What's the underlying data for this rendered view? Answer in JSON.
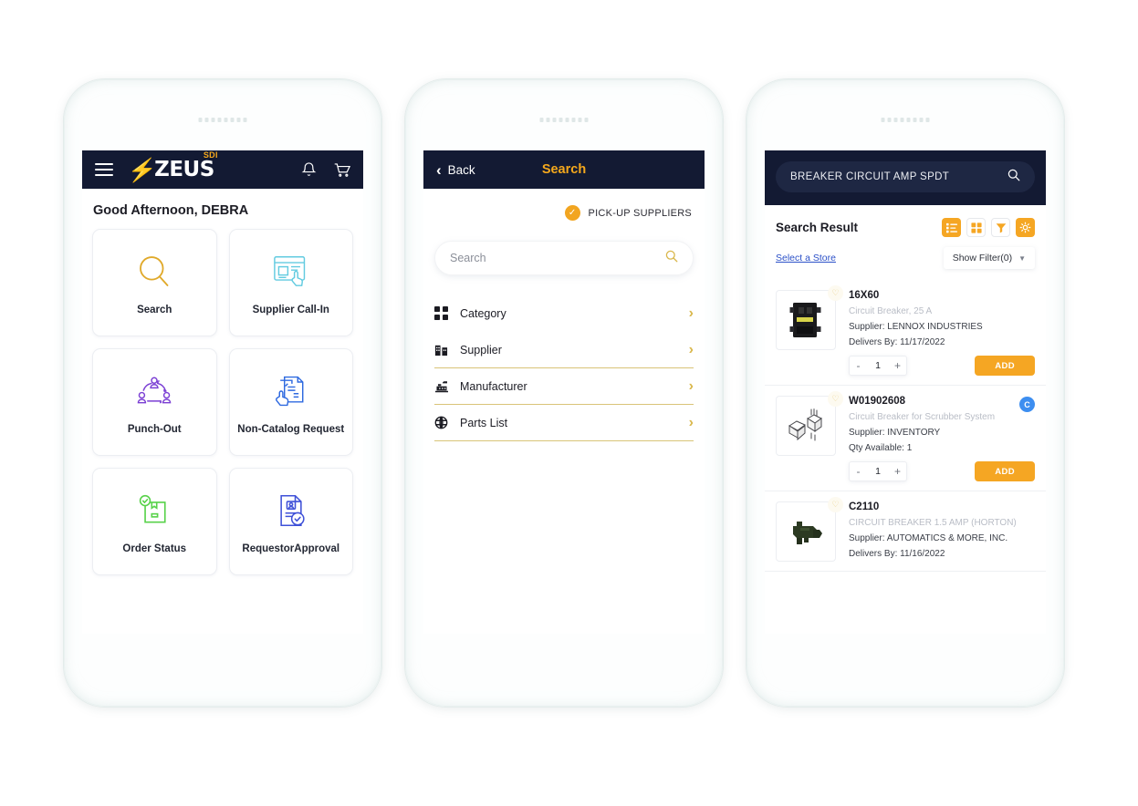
{
  "colors": {
    "nav_dark": "#131a33",
    "accent_orange": "#f5a623",
    "gold": "#d9b74b",
    "link_blue": "#2b50c8",
    "badge_blue": "#3d8ef0"
  },
  "phone_home": {
    "navbar": {
      "menu_icon": "hamburger-icon",
      "logo_bolt": "⚡",
      "logo_text": "ZEUS",
      "logo_super": "SDI",
      "bell_icon": "bell-icon",
      "cart_icon": "cart-icon"
    },
    "greeting": "Good Afternoon, DEBRA",
    "tiles": [
      {
        "label": "Search",
        "icon": "magnifier-icon",
        "color": "#e0a92a"
      },
      {
        "label": "Supplier Call-In",
        "icon": "window-click-icon",
        "color": "#62cbe0"
      },
      {
        "label": "Punch-Out",
        "icon": "network-users-icon",
        "color": "#7b3fd4"
      },
      {
        "label": "Non-Catalog\nRequest",
        "icon": "documents-hand-icon",
        "color": "#2f6ae0"
      },
      {
        "label": "Order Status",
        "icon": "box-check-icon",
        "color": "#58d24a"
      },
      {
        "label": "RequestorApproval",
        "icon": "document-person-check-icon",
        "color": "#3f51d8"
      }
    ]
  },
  "phone_search": {
    "navbar": {
      "back_label": "Back",
      "title": "Search",
      "back_icon": "chevron-left-icon"
    },
    "pickup": {
      "label": "PICK-UP SUPPLIERS",
      "checked": true,
      "icon": "check-circle-icon"
    },
    "search": {
      "value": "",
      "placeholder": "Search",
      "icon": "search-icon"
    },
    "menu_items": [
      {
        "label": "Category",
        "icon": "grid-squares-icon",
        "ruled": false
      },
      {
        "label": "Supplier",
        "icon": "building-icon",
        "ruled": true
      },
      {
        "label": "Manufacturer",
        "icon": "factory-icon",
        "ruled": true
      },
      {
        "label": "Parts List",
        "icon": "globe-grid-icon",
        "ruled": true
      }
    ],
    "chevron_icon": "chevron-right-icon"
  },
  "phone_results": {
    "search": {
      "value": "BREAKER CIRCUIT AMP SPDT",
      "placeholder": "Search",
      "icon": "search-icon"
    },
    "result_title": "Search Result",
    "toolbar": [
      {
        "name": "list-view-button",
        "icon": "list-view-icon",
        "style": "solid"
      },
      {
        "name": "grid-view-button",
        "icon": "grid-view-icon",
        "style": "ghost"
      },
      {
        "name": "filter-button",
        "icon": "funnel-icon",
        "style": "ghost"
      },
      {
        "name": "settings-button",
        "icon": "gear-icon",
        "style": "solid"
      }
    ],
    "store_link": "Select a Store",
    "show_filter": {
      "label": "Show Filter(0)",
      "caret": "▼"
    },
    "products": [
      {
        "code": "16X60",
        "description": "Circuit Breaker, 25 A",
        "supplier": "Supplier: LENNOX INDUSTRIES",
        "meta2": "Delivers By:  11/17/2022",
        "qty": "1",
        "add_label": "ADD",
        "minus": "-",
        "plus": "+",
        "badge": null,
        "thumb": "black-breaker-photo"
      },
      {
        "code": "W01902608",
        "description": "Circuit Breaker for Scrubber System",
        "supplier": "Supplier: INVENTORY",
        "meta2": "Qty Available: 1",
        "qty": "1",
        "add_label": "ADD",
        "minus": "-",
        "plus": "+",
        "badge": "C",
        "thumb": "line-drawing-breaker"
      },
      {
        "code": "C2110",
        "description": "CIRCUIT BREAKER 1.5 AMP  (HORTON)",
        "supplier": "Supplier: AUTOMATICS & MORE, INC.",
        "meta2": "Delivers By:  11/16/2022",
        "qty": "1",
        "add_label": "ADD",
        "minus": "-",
        "plus": "+",
        "badge": null,
        "thumb": "green-breaker-photo"
      }
    ],
    "fav_icon": "heart-outline-icon"
  }
}
